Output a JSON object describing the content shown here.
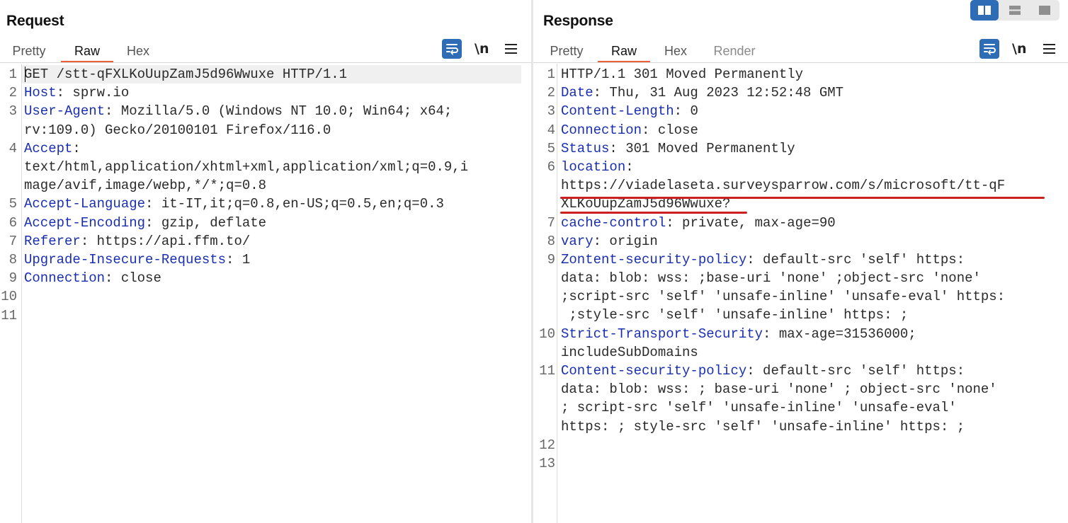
{
  "request": {
    "title": "Request",
    "tabs": [
      "Pretty",
      "Raw",
      "Hex"
    ],
    "active_tab": "Raw",
    "newline_toggle": "\\n",
    "line_numbers": [
      "1",
      "2",
      "3",
      "",
      "4",
      "",
      "",
      "5",
      "6",
      "7",
      "8",
      "9",
      "10",
      "11"
    ],
    "lines": [
      [
        {
          "t": "GET /stt-qFXLKoUupZamJ5d96Wwuxe HTTP/1.1",
          "k": false
        }
      ],
      [
        {
          "t": "Host",
          "k": true
        },
        {
          "t": ": sprw.io",
          "k": false
        }
      ],
      [
        {
          "t": "User-Agent",
          "k": true
        },
        {
          "t": ": Mozilla/5.0 (Windows NT 10.0; Win64; x64;",
          "k": false
        }
      ],
      [
        {
          "t": "rv:109.0) Gecko/20100101 Firefox/116.0",
          "k": false
        }
      ],
      [
        {
          "t": "Accept",
          "k": true
        },
        {
          "t": ":",
          "k": false
        }
      ],
      [
        {
          "t": "text/html,application/xhtml+xml,application/xml;q=0.9,i",
          "k": false
        }
      ],
      [
        {
          "t": "mage/avif,image/webp,*/*;q=0.8",
          "k": false
        }
      ],
      [
        {
          "t": "Accept-Language",
          "k": true
        },
        {
          "t": ": it-IT,it;q=0.8,en-US;q=0.5,en;q=0.3",
          "k": false
        }
      ],
      [
        {
          "t": "Accept-Encoding",
          "k": true
        },
        {
          "t": ": gzip, deflate",
          "k": false
        }
      ],
      [
        {
          "t": "Referer",
          "k": true
        },
        {
          "t": ": https://api.ffm.to/",
          "k": false
        }
      ],
      [
        {
          "t": "Upgrade-Insecure-Requests",
          "k": true
        },
        {
          "t": ": 1",
          "k": false
        }
      ],
      [
        {
          "t": "Connection",
          "k": true
        },
        {
          "t": ": close",
          "k": false
        }
      ]
    ]
  },
  "response": {
    "title": "Response",
    "tabs": [
      "Pretty",
      "Raw",
      "Hex",
      "Render"
    ],
    "active_tab": "Raw",
    "newline_toggle": "\\n",
    "line_numbers": [
      "1",
      "2",
      "3",
      "4",
      "5",
      "6",
      "",
      "",
      "7",
      "8",
      "9",
      "",
      "",
      "",
      "10",
      "",
      "11",
      "",
      "",
      "",
      "12",
      "13"
    ],
    "lines": [
      [
        {
          "t": "HTTP/1.1 301 Moved Permanently",
          "k": false
        }
      ],
      [
        {
          "t": "Date",
          "k": true
        },
        {
          "t": ": Thu, 31 Aug 2023 12:52:48 GMT",
          "k": false
        }
      ],
      [
        {
          "t": "Content-Length",
          "k": true
        },
        {
          "t": ": 0",
          "k": false
        }
      ],
      [
        {
          "t": "Connection",
          "k": true
        },
        {
          "t": ": close",
          "k": false
        }
      ],
      [
        {
          "t": "Status",
          "k": true
        },
        {
          "t": ": 301 Moved Permanently",
          "k": false
        }
      ],
      [
        {
          "t": "location",
          "k": true
        },
        {
          "t": ":",
          "k": false
        }
      ],
      [
        {
          "t": "https://viadelaseta.surveysparrow.com/s/microsoft/tt-qF",
          "k": false
        }
      ],
      [
        {
          "t": "XLKoUupZamJ5d96Wwuxe?",
          "k": false
        }
      ],
      [
        {
          "t": "cache-control",
          "k": true
        },
        {
          "t": ": private, max-age=90",
          "k": false
        }
      ],
      [
        {
          "t": "vary",
          "k": true
        },
        {
          "t": ": origin",
          "k": false
        }
      ],
      [
        {
          "t": "Zontent-security-policy",
          "k": true
        },
        {
          "t": ": default-src 'self' https:",
          "k": false
        }
      ],
      [
        {
          "t": "data: blob: wss: ;base-uri 'none' ;object-src 'none'",
          "k": false
        }
      ],
      [
        {
          "t": ";script-src 'self' 'unsafe-inline' 'unsafe-eval' https:",
          "k": false
        }
      ],
      [
        {
          "t": " ;style-src 'self' 'unsafe-inline' https: ;",
          "k": false
        }
      ],
      [
        {
          "t": "Strict-Transport-Security",
          "k": true
        },
        {
          "t": ": max-age=31536000;",
          "k": false
        }
      ],
      [
        {
          "t": "includeSubDomains",
          "k": false
        }
      ],
      [
        {
          "t": "Content-security-policy",
          "k": true
        },
        {
          "t": ": default-src 'self' https:",
          "k": false
        }
      ],
      [
        {
          "t": "data: blob: wss: ; base-uri 'none' ; object-src 'none'",
          "k": false
        }
      ],
      [
        {
          "t": "; script-src 'self' 'unsafe-inline' 'unsafe-eval'",
          "k": false
        }
      ],
      [
        {
          "t": "https: ; style-src 'self' 'unsafe-inline' https: ;",
          "k": false
        }
      ]
    ]
  },
  "layout_modes": [
    "split-columns-icon",
    "split-rows-icon",
    "single-pane-icon"
  ],
  "colors": {
    "accent": "#2e6cb5",
    "tab_underline": "#e8613a",
    "header_key": "#1a2fb0",
    "highlight": "#cc1f1f"
  }
}
